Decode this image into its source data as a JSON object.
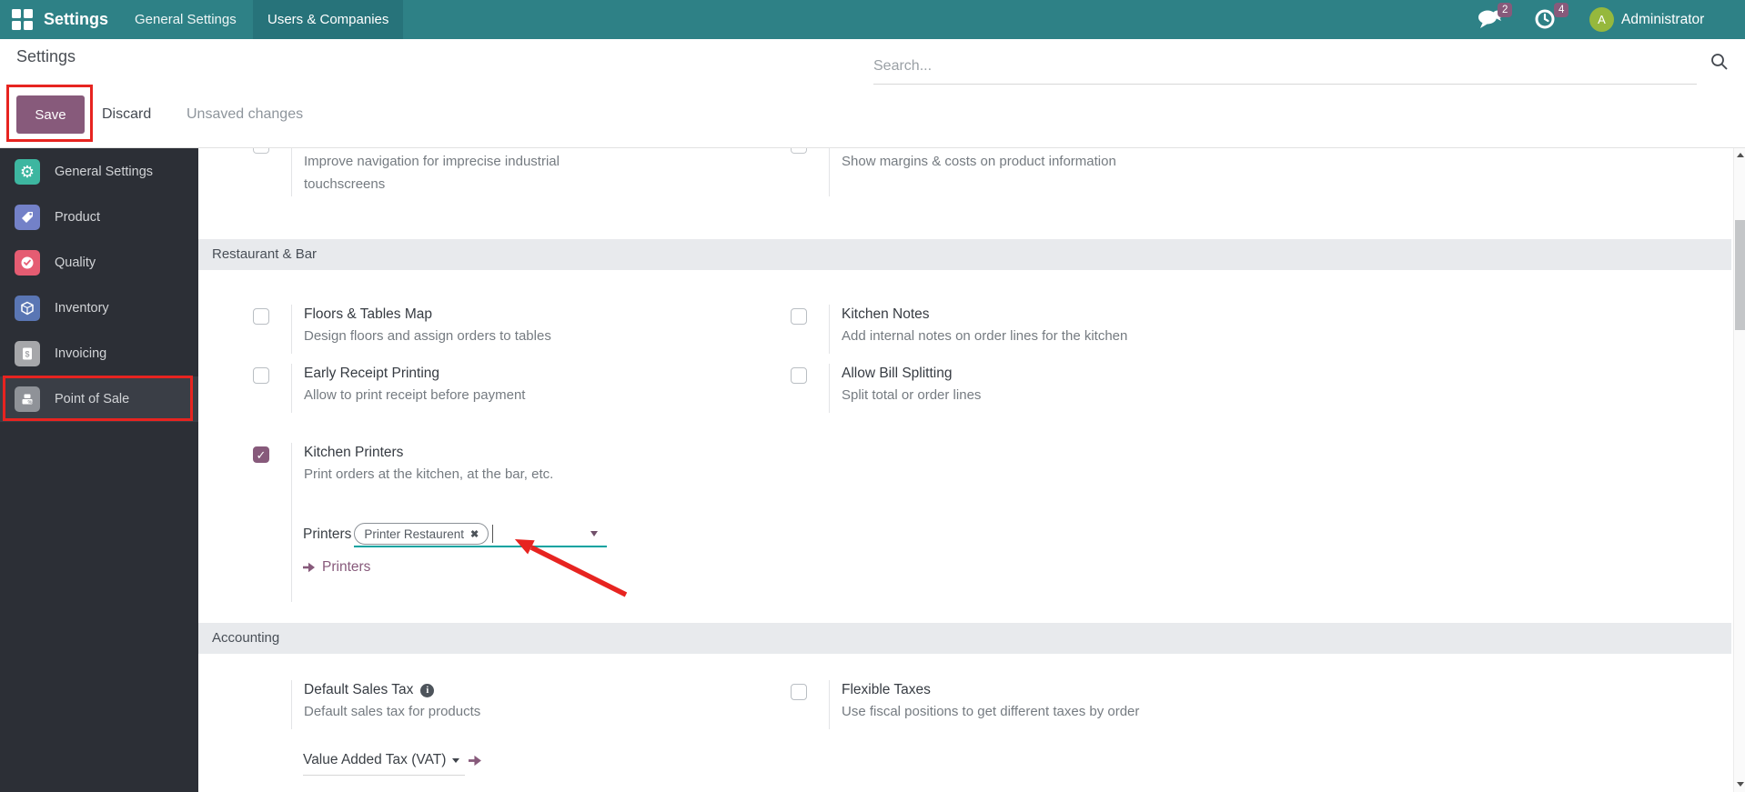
{
  "navbar": {
    "brand": "Settings",
    "menu_general_settings": "General Settings",
    "menu_users_companies": "Users & Companies",
    "messages_badge": "2",
    "activities_badge": "4",
    "avatar_letter": "A",
    "user_name": "Administrator"
  },
  "control_panel": {
    "breadcrumb": "Settings",
    "save_label": "Save",
    "discard_label": "Discard",
    "status_label": "Unsaved changes",
    "search_placeholder": "Search..."
  },
  "sidebar": {
    "items": [
      {
        "label": "General Settings",
        "icon": "gear-icon",
        "color": "#3db6a0"
      },
      {
        "label": "Product",
        "icon": "tag-icon",
        "color": "#7381c8"
      },
      {
        "label": "Quality",
        "icon": "quality-badge-icon",
        "color": "#e55c72"
      },
      {
        "label": "Inventory",
        "icon": "cube-icon",
        "color": "#5a76b4"
      },
      {
        "label": "Invoicing",
        "icon": "invoice-icon",
        "color": "#a6a7aa"
      },
      {
        "label": "Point of Sale",
        "icon": "cash-register-icon",
        "color": "#8f9298",
        "selected": true
      }
    ]
  },
  "content": {
    "partial_row": {
      "left_desc": "Improve navigation for imprecise industrial touchscreens",
      "right_desc": "Show margins & costs on product information"
    },
    "restaurant_bar": {
      "section_title": "Restaurant & Bar",
      "floors": {
        "title": "Floors & Tables Map",
        "desc": "Design floors and assign orders to tables",
        "checked": false
      },
      "kitchen_notes": {
        "title": "Kitchen Notes",
        "desc": "Add internal notes on order lines for the kitchen",
        "checked": false
      },
      "early_receipt": {
        "title": "Early Receipt Printing",
        "desc": "Allow to print receipt before payment",
        "checked": false
      },
      "bill_splitting": {
        "title": "Allow Bill Splitting",
        "desc": "Split total or order lines",
        "checked": false
      },
      "kitchen_printers": {
        "title": "Kitchen Printers",
        "desc": "Print orders at the kitchen, at the bar, etc.",
        "checked": true
      },
      "printers_field": {
        "label": "Printers",
        "tag": "Printer Restaurent",
        "remove_glyph": "✖"
      },
      "printers_link": "Printers"
    },
    "accounting": {
      "section_title": "Accounting",
      "default_sales_tax": {
        "title": "Default Sales Tax",
        "desc": "Default sales tax for products",
        "value": "Value Added Tax (VAT)"
      },
      "flexible_taxes": {
        "title": "Flexible Taxes",
        "desc": "Use fiscal positions to get different taxes by order",
        "checked": false
      }
    }
  },
  "colors": {
    "accent": "#875A7B",
    "navbar_teal": "#2e8186",
    "annotation_red": "#e72420",
    "focus_underline": "#04a2a0",
    "avatar_green": "#96b83d"
  }
}
